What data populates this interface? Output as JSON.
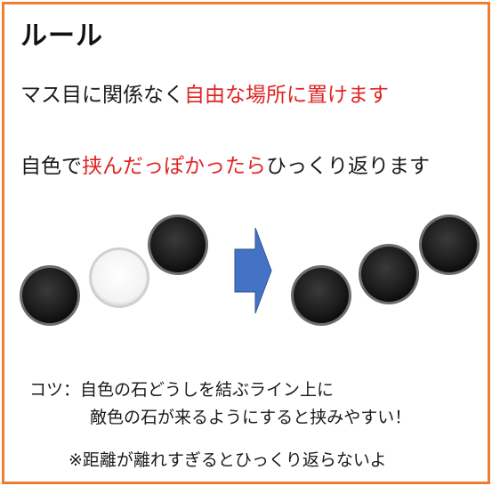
{
  "title": "ルール",
  "rule1": {
    "normal": "マス目に関係なく",
    "highlight": "自由な場所に置けます"
  },
  "rule2": {
    "prefix": "自色で",
    "highlight": "挟んだっぽかったら",
    "suffix": "ひっくり返ります"
  },
  "tips": {
    "line1": "コツ：自色の石どうしを結ぶライン上に",
    "line2": "敵色の石が来るようにすると挟みやすい！"
  },
  "note": "※距離が離れすぎるとひっくり返らないよ",
  "colors": {
    "frame": "#ED7D31",
    "highlight": "#E02424",
    "arrow": "#4472C4",
    "stone_black": "#1c1c1c",
    "stone_white": "#ffffff"
  },
  "illustration": {
    "before": [
      "black",
      "white",
      "black"
    ],
    "arrow_icon": "right-arrow-icon",
    "after": [
      "black",
      "black",
      "black"
    ]
  }
}
